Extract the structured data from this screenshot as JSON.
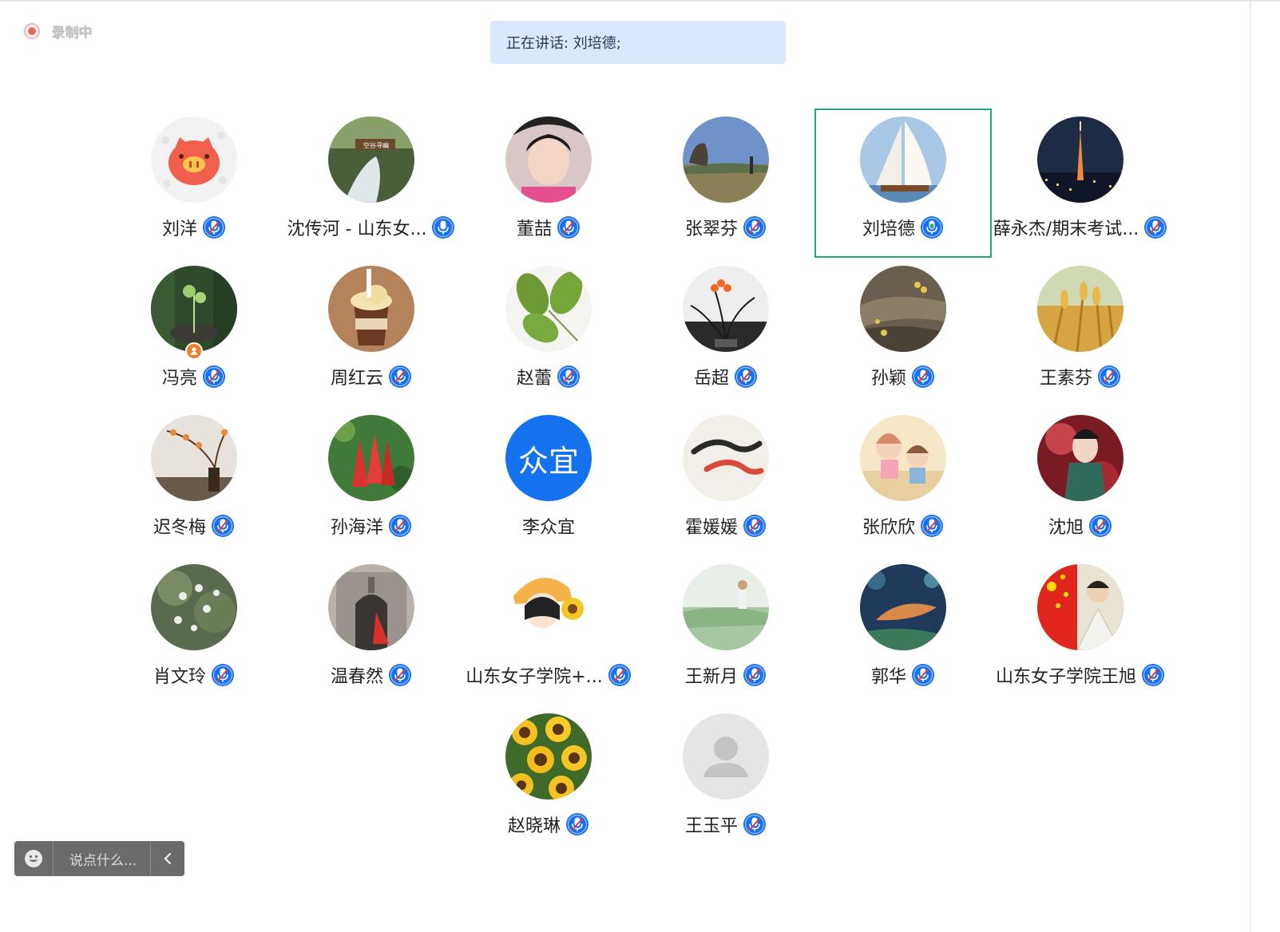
{
  "recording": {
    "label": "录制中",
    "color": "#f0665c"
  },
  "speaking": {
    "text": "正在讲话: 刘培德;"
  },
  "colors": {
    "mic_blue": "#1670f0",
    "mic_active": "#2fb36a",
    "active_border": "#27a96b",
    "avatar_default_bg": "#e5e5e5"
  },
  "participants": [
    {
      "name": "刘洋",
      "avatar": "pig-icon",
      "mic": "muted"
    },
    {
      "name": "沈传河 - 山东女...",
      "avatar": "waterfall-photo",
      "mic": "on"
    },
    {
      "name": "董喆",
      "avatar": "selfie-photo",
      "mic": "muted"
    },
    {
      "name": "张翠芬",
      "avatar": "landscape-photo",
      "mic": "muted"
    },
    {
      "name": "刘培德",
      "avatar": "sailboat-photo",
      "mic": "speaking",
      "active": true
    },
    {
      "name": "薛永杰/期末考试...",
      "avatar": "city-tower-photo",
      "mic": "muted"
    },
    {
      "name": "冯亮",
      "avatar": "bonsai-photo",
      "mic": "muted",
      "host": true
    },
    {
      "name": "周红云",
      "avatar": "ice-cream-photo",
      "mic": "muted"
    },
    {
      "name": "赵蕾",
      "avatar": "leaves-photo",
      "mic": "muted"
    },
    {
      "name": "岳超",
      "avatar": "orchid-photo",
      "mic": "muted"
    },
    {
      "name": "孙颖",
      "avatar": "rock-flowers-photo",
      "mic": "muted"
    },
    {
      "name": "王素芬",
      "avatar": "wheat-photo",
      "mic": "muted"
    },
    {
      "name": "迟冬梅",
      "avatar": "ikebana-photo",
      "mic": "muted"
    },
    {
      "name": "孙海洋",
      "avatar": "red-bells-photo",
      "mic": "muted"
    },
    {
      "name": "李众宜",
      "avatar": "initials-avatar",
      "initials": "众宜",
      "mic": "none"
    },
    {
      "name": "霍媛媛",
      "avatar": "koi-painting",
      "mic": "muted"
    },
    {
      "name": "张欣欣",
      "avatar": "cartoon-kids",
      "mic": "muted"
    },
    {
      "name": "沈旭",
      "avatar": "anime-art",
      "mic": "muted"
    },
    {
      "name": "肖文玲",
      "avatar": "white-flowers-photo",
      "mic": "muted"
    },
    {
      "name": "温春然",
      "avatar": "church-photo",
      "mic": "muted"
    },
    {
      "name": "山东女子学院+...",
      "avatar": "girl-sunflower-cartoon",
      "mic": "muted"
    },
    {
      "name": "王新月",
      "avatar": "field-photo",
      "mic": "muted"
    },
    {
      "name": "郭华",
      "avatar": "fish-painting",
      "mic": "muted"
    },
    {
      "name": "山东女子学院王旭",
      "avatar": "flag-child-photo",
      "mic": "muted"
    },
    {
      "name": "赵晓琳",
      "avatar": "sunflowers-photo",
      "mic": "muted"
    },
    {
      "name": "王玉平",
      "avatar": "default-user-icon",
      "mic": "muted"
    }
  ],
  "chat": {
    "placeholder": "说点什么..."
  }
}
